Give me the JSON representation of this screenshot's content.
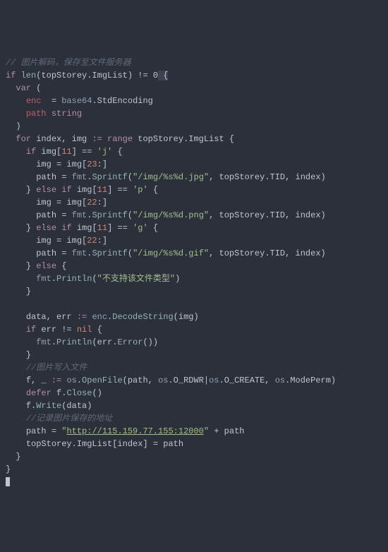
{
  "lines": {
    "c1": "// 图片解码，保存至文件服务器",
    "l2a": "if",
    "l2b": "len",
    "l2c": "(topStorey.ImgList) ",
    "l2d": "!= 0",
    "l2e": " {",
    "l3a": "var",
    "l3b": " (",
    "l4a": "enc ",
    "l4b": " = ",
    "l4c": "base64",
    "l4d": ".StdEncoding",
    "l5a": "path ",
    "l5b": "string",
    "l6": ")",
    "l7a": "for",
    "l7b": " index, img ",
    "l7c": ":=",
    "l7d": " ",
    "l7e": "range",
    "l7f": " topStorey.ImgList {",
    "l8a": "if",
    "l8b": " img[",
    "l8c": "11",
    "l8d": "] == ",
    "l8e": "'j'",
    "l8f": " {",
    "l9a": "img = img[",
    "l9b": "23",
    "l9c": ":]",
    "l10a": "path = ",
    "l10b": "fmt",
    "l10c": ".",
    "l10d": "Sprintf",
    "l10e": "(",
    "l10f": "\"/img/%s%d.jpg\"",
    "l10g": ", topStorey.TID, index)",
    "l11a": "} ",
    "l11b": "else if",
    "l11c": " img[",
    "l11d": "11",
    "l11e": "] == ",
    "l11f": "'p'",
    "l11g": " {",
    "l12a": "img = img[",
    "l12b": "22",
    "l12c": ":]",
    "l13a": "path = ",
    "l13b": "fmt",
    "l13c": ".",
    "l13d": "Sprintf",
    "l13e": "(",
    "l13f": "\"/img/%s%d.png\"",
    "l13g": ", topStorey.TID, index)",
    "l14a": "} ",
    "l14b": "else if",
    "l14c": " img[",
    "l14d": "11",
    "l14e": "] == ",
    "l14f": "'g'",
    "l14g": " {",
    "l15a": "img = img[",
    "l15b": "22",
    "l15c": ":]",
    "l16a": "path = ",
    "l16b": "fmt",
    "l16c": ".",
    "l16d": "Sprintf",
    "l16e": "(",
    "l16f": "\"/img/%s%d.gif\"",
    "l16g": ", topStorey.TID, index)",
    "l17a": "} ",
    "l17b": "else",
    "l17c": " {",
    "l18a": "fmt",
    "l18b": ".",
    "l18c": "Println",
    "l18d": "(",
    "l18e": "\"不支持该文件类型\"",
    "l18f": ")",
    "l19": "}",
    "l21a": "data, err ",
    "l21b": ":=",
    "l21c": " ",
    "l21d": "enc",
    "l21e": ".",
    "l21f": "DecodeString",
    "l21g": "(img)",
    "l22a": "if",
    "l22b": " err != ",
    "l22c": "nil",
    "l22d": " {",
    "l23a": "fmt",
    "l23b": ".",
    "l23c": "Println",
    "l23d": "(err.",
    "l23e": "Error",
    "l23f": "())",
    "l24": "}",
    "c25": "//图片写入文件",
    "l26a": "f, _ ",
    "l26b": ":=",
    "l26c": " ",
    "l26d": "os",
    "l26e": ".",
    "l26f": "OpenFile",
    "l26g": "(path, ",
    "l26h": "os",
    "l26i": ".O_RDWR|",
    "l26j": "os",
    "l26k": ".O_CREATE, ",
    "l26l": "os",
    "l26m": ".ModePerm)",
    "l27a": "defer",
    "l27b": " f.",
    "l27c": "Close",
    "l27d": "()",
    "l28a": "f.",
    "l28b": "Write",
    "l28c": "(data)",
    "c29": "//记录图片保存的地址",
    "l30a": "path = ",
    "l30b": "\"",
    "l30c": "http://115.159.77.155:12000",
    "l30d": "\"",
    "l30e": " + path",
    "l31": "topStorey.ImgList[index] = path",
    "l32": "}",
    "l33": "}"
  }
}
